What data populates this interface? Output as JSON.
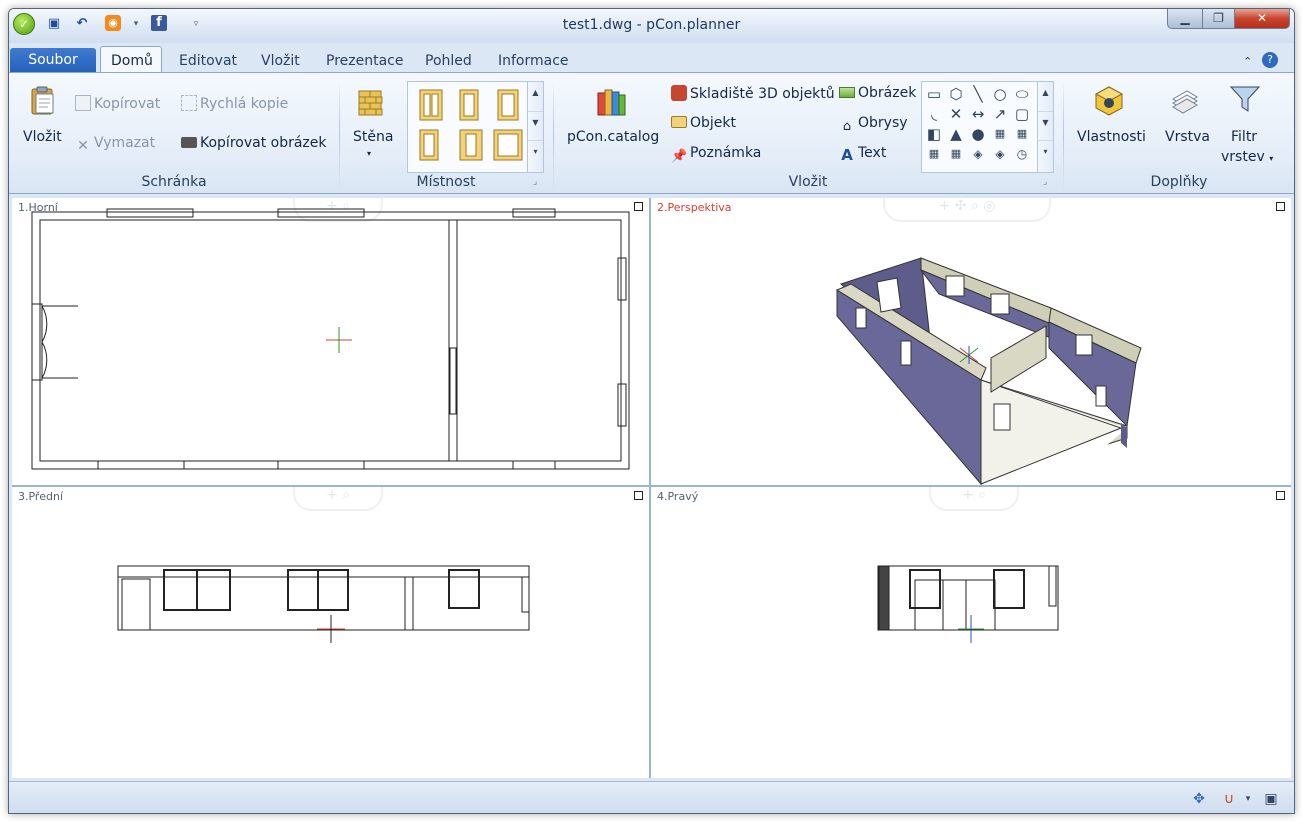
{
  "window": {
    "title": "test1.dwg - pCon.planner",
    "app_icon": "pcon-logo-icon"
  },
  "quick_access": [
    {
      "name": "save-icon",
      "glyph": "💾"
    },
    {
      "name": "undo-icon",
      "glyph": "↶"
    },
    {
      "name": "rss-icon",
      "glyph": "◉"
    },
    {
      "name": "dropdown-arrow-icon",
      "glyph": "▾"
    },
    {
      "name": "facebook-icon",
      "glyph": "f"
    },
    {
      "name": "customize-qat-icon",
      "glyph": "▿"
    }
  ],
  "window_controls": {
    "minimize": "▁",
    "restore": "❐",
    "close": "✕"
  },
  "tabs": {
    "file": "Soubor",
    "items": [
      "Domů",
      "Editovat",
      "Vložit",
      "Prezentace",
      "Pohled",
      "Informace"
    ]
  },
  "ribbon": {
    "clipboard": {
      "label": "Schránka",
      "paste": "Vložit",
      "copy": "Kopírovat",
      "cut": "Vymazat",
      "quick_copy": "Rychlá kopie",
      "copy_image": "Kopírovat obrázek"
    },
    "room": {
      "label": "Místnost",
      "wall": "Stěna"
    },
    "insert": {
      "label": "Vložit",
      "catalog": "pCon.catalog",
      "warehouse": "Skladiště 3D objektů",
      "object": "Objekt",
      "note": "Poznámka",
      "image": "Obrázek",
      "outlines": "Obrysy",
      "text": "Text"
    },
    "addons": {
      "label": "Doplňky",
      "properties": "Vlastnosti",
      "layer": "Vrstva",
      "layer_filter_1": "Filtr",
      "layer_filter_2": "vrstev"
    }
  },
  "viewports": {
    "top": {
      "label": "1.Horní"
    },
    "perspective": {
      "label": "2.Perspektiva",
      "color": "#e03c31"
    },
    "front": {
      "label": "3.Přední"
    },
    "right": {
      "label": "4.Pravý"
    }
  },
  "status_icons": [
    "navigation-cross-icon",
    "snap-magnet-icon",
    "dropdown-arrow-icon",
    "window-layout-icon"
  ]
}
